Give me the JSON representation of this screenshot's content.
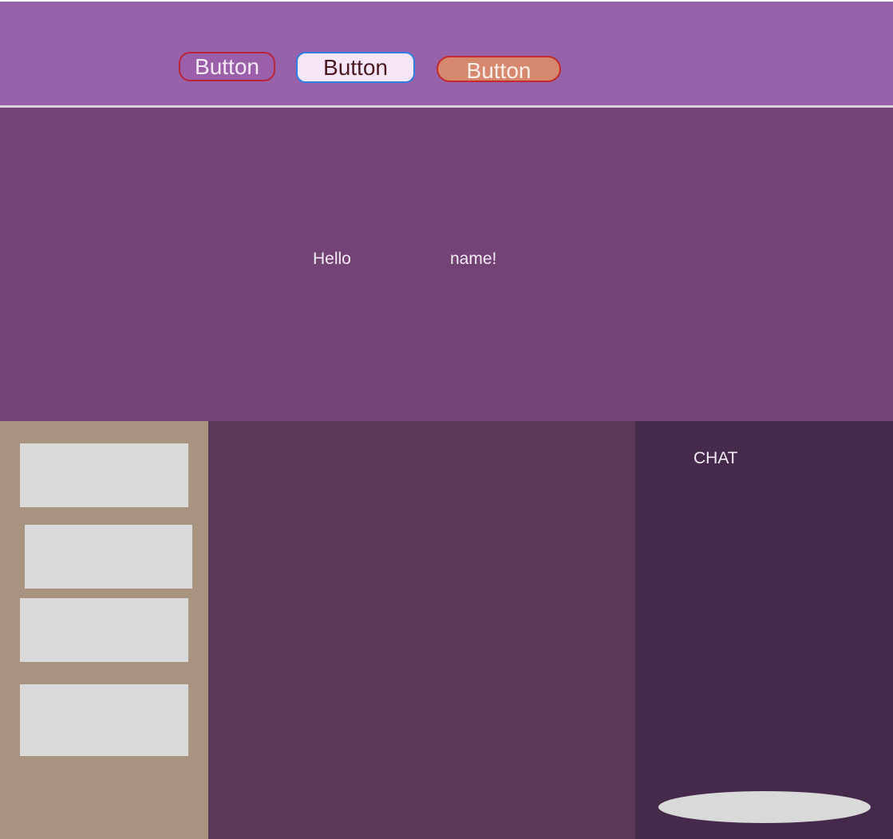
{
  "header": {
    "buttons": [
      {
        "label": "Button"
      },
      {
        "label": "Button"
      },
      {
        "label": "Button"
      }
    ]
  },
  "hero": {
    "greeting": "Hello",
    "name": "name!"
  },
  "chat": {
    "title": "CHAT"
  },
  "colors": {
    "header_bg": "#9762aa",
    "hero_bg": "#724374",
    "left_panel_bg": "#a89380",
    "center_panel_bg": "#5b3858",
    "chat_panel_bg": "#462a4b",
    "card_bg": "#d9d9d9"
  }
}
